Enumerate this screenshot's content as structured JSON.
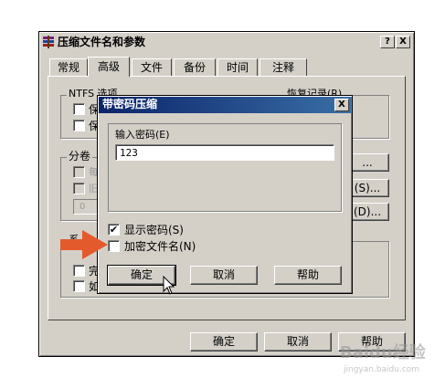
{
  "main_window": {
    "title": "压缩文件名和参数",
    "help_btn": "?",
    "close_btn": "X",
    "tabs": [
      {
        "label": "常规"
      },
      {
        "label": "高级"
      },
      {
        "label": "文件"
      },
      {
        "label": "备份"
      },
      {
        "label": "时间"
      },
      {
        "label": "注释"
      }
    ],
    "ntfs_group": "NTFS 选项",
    "recovery_group": "恢复记录(R)",
    "ntfs_items": [
      "保",
      "保"
    ],
    "split_group": "分卷",
    "split_items": [
      "每",
      "旧"
    ],
    "split_field": "0",
    "sys_group": "系",
    "sys_items": [
      "完",
      "如"
    ],
    "side_buttons": [
      "...",
      "(S)...",
      "(D)..."
    ],
    "ok": "确定",
    "cancel": "取消",
    "help": "帮助"
  },
  "dialog": {
    "title": "带密码压缩",
    "close_btn": "X",
    "password_label": "输入密码(E)",
    "password_value": "123",
    "show_password": "显示密码(S)",
    "show_password_checked": "✔",
    "encrypt_filenames": "加密文件名(N)",
    "ok": "确定",
    "cancel": "取消",
    "help": "帮助"
  },
  "watermark": "Baidu经验",
  "watermark_url": "jingyan.baidu.com",
  "colors": {
    "arrow": "#e35a2c"
  }
}
